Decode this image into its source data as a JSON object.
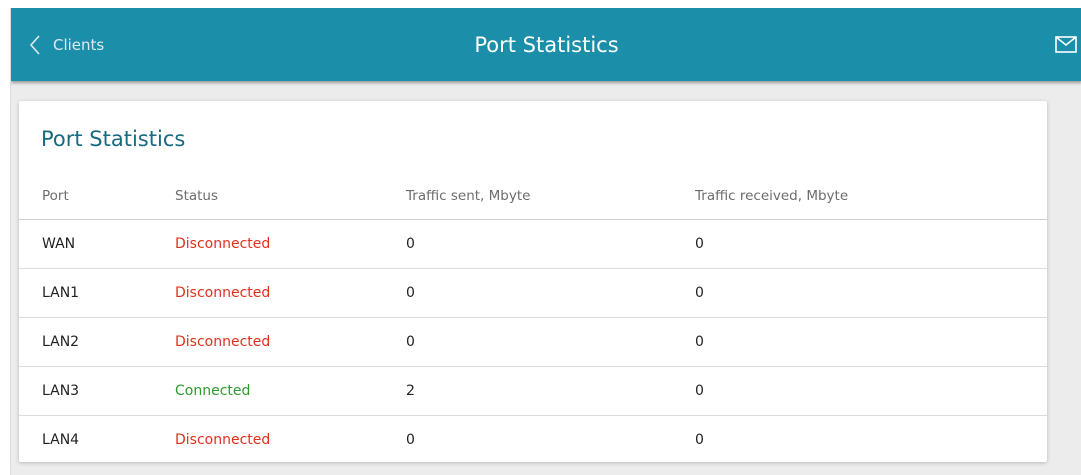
{
  "header": {
    "back_label": "Clients",
    "title": "Port Statistics",
    "mail_icon": "envelope-icon"
  },
  "card": {
    "title": "Port Statistics",
    "columns": [
      "Port",
      "Status",
      "Traffic sent, Mbyte",
      "Traffic received, Mbyte"
    ],
    "rows": [
      {
        "port": "WAN",
        "status": "Disconnected",
        "sent": "0",
        "received": "0",
        "connected": false
      },
      {
        "port": "LAN1",
        "status": "Disconnected",
        "sent": "0",
        "received": "0",
        "connected": false
      },
      {
        "port": "LAN2",
        "status": "Disconnected",
        "sent": "0",
        "received": "0",
        "connected": false
      },
      {
        "port": "LAN3",
        "status": "Connected",
        "sent": "2",
        "received": "0",
        "connected": true
      },
      {
        "port": "LAN4",
        "status": "Disconnected",
        "sent": "0",
        "received": "0",
        "connected": false
      }
    ]
  },
  "colors": {
    "header_bg": "#1b8fa9",
    "title_text": "#176a80",
    "disconnected": "#e0301e",
    "connected": "#2e9a2e"
  }
}
